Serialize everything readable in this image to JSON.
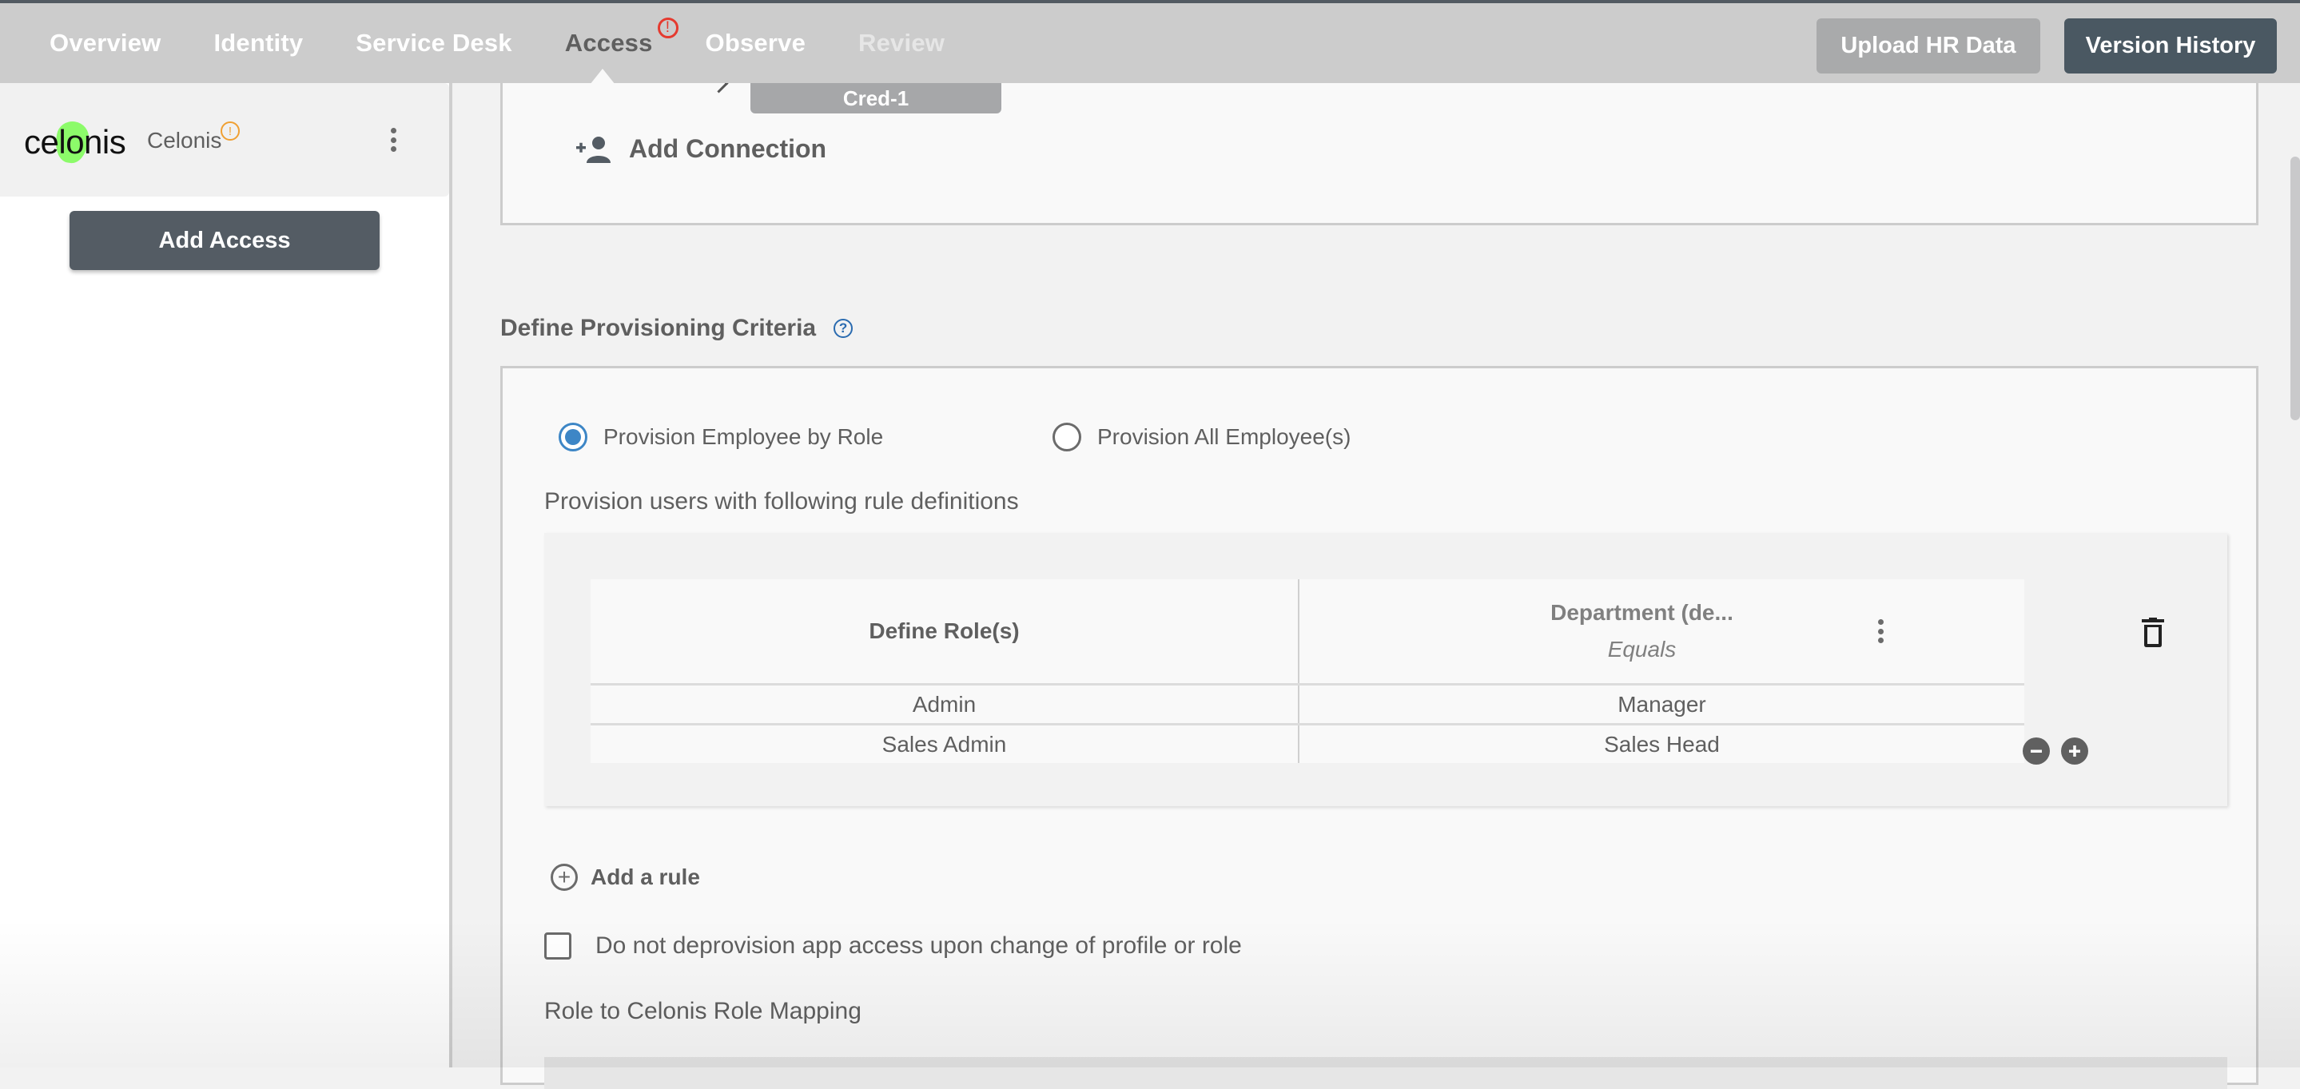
{
  "topbar": {
    "tabs": [
      {
        "label": "Overview",
        "state": "normal"
      },
      {
        "label": "Identity",
        "state": "normal"
      },
      {
        "label": "Service Desk",
        "state": "normal"
      },
      {
        "label": "Access",
        "state": "active",
        "badge": "!"
      },
      {
        "label": "Observe",
        "state": "normal"
      },
      {
        "label": "Review",
        "state": "disabled"
      }
    ],
    "upload_label": "Upload HR Data",
    "version_label": "Version History"
  },
  "sidebar": {
    "logo_text": "celonis",
    "app_name": "Celonis",
    "app_warning": "!",
    "add_access_label": "Add Access"
  },
  "connection": {
    "credential": "Cred-1",
    "add_connection_label": "Add Connection"
  },
  "criteria": {
    "title": "Define Provisioning Criteria",
    "help": "?",
    "options": [
      {
        "label": "Provision Employee by Role",
        "checked": true
      },
      {
        "label": "Provision All Employee(s)",
        "checked": false
      }
    ],
    "rules_heading": "Provision users with following rule definitions",
    "table": {
      "col1_header": "Define Role(s)",
      "col2_header": "Department (de...",
      "col2_operator": "Equals",
      "rows": [
        {
          "role": "Admin",
          "department": "Manager"
        },
        {
          "role": "Sales Admin",
          "department": "Sales Head"
        }
      ]
    },
    "add_rule_label": "Add a rule",
    "no_deprovision_label": "Do not deprovision app access upon change of profile or role",
    "no_deprovision_checked": false,
    "mapping_heading": "Role to Celonis Role Mapping"
  },
  "colors": {
    "accent_blue": "#3d86c6",
    "alert_red": "#e53a2f",
    "warning_orange": "#f0a032",
    "dark_button": "#4a5862",
    "logo_green": "#8cfb6a"
  }
}
